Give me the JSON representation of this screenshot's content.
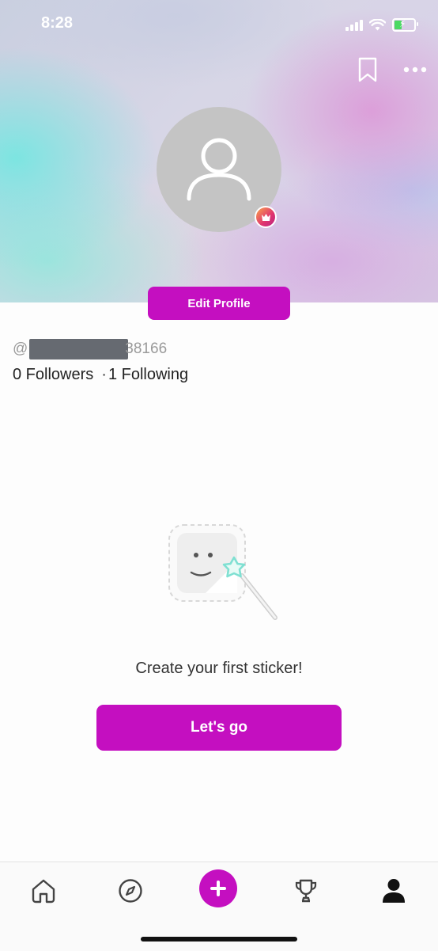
{
  "status_bar": {
    "time": "8:28",
    "icons": [
      "signal-icon",
      "wifi-icon",
      "battery-charging-icon"
    ]
  },
  "header": {
    "bookmark_icon": "bookmark-icon",
    "more_icon": "more-horizontal-icon",
    "avatar_icon": "user-placeholder-icon",
    "badge_icon": "crown-icon"
  },
  "profile": {
    "edit_label": "Edit Profile",
    "username_prefix": "@",
    "username_suffix": "38166",
    "followers": "0 Followers",
    "separator": "·",
    "following": "1 Following"
  },
  "empty_state": {
    "illustration": "sticker-wand-illustration",
    "message": "Create your first sticker!",
    "button_label": "Let's go"
  },
  "bottom_nav": {
    "items": [
      {
        "name": "home",
        "icon": "home-icon"
      },
      {
        "name": "explore",
        "icon": "compass-icon"
      },
      {
        "name": "create",
        "icon": "plus-icon"
      },
      {
        "name": "challenges",
        "icon": "trophy-icon"
      },
      {
        "name": "profile",
        "icon": "person-icon",
        "active": true
      }
    ]
  },
  "colors": {
    "accent": "#c40fc0",
    "avatar_bg": "#c4c4c4",
    "star": "#7fe0d2"
  }
}
